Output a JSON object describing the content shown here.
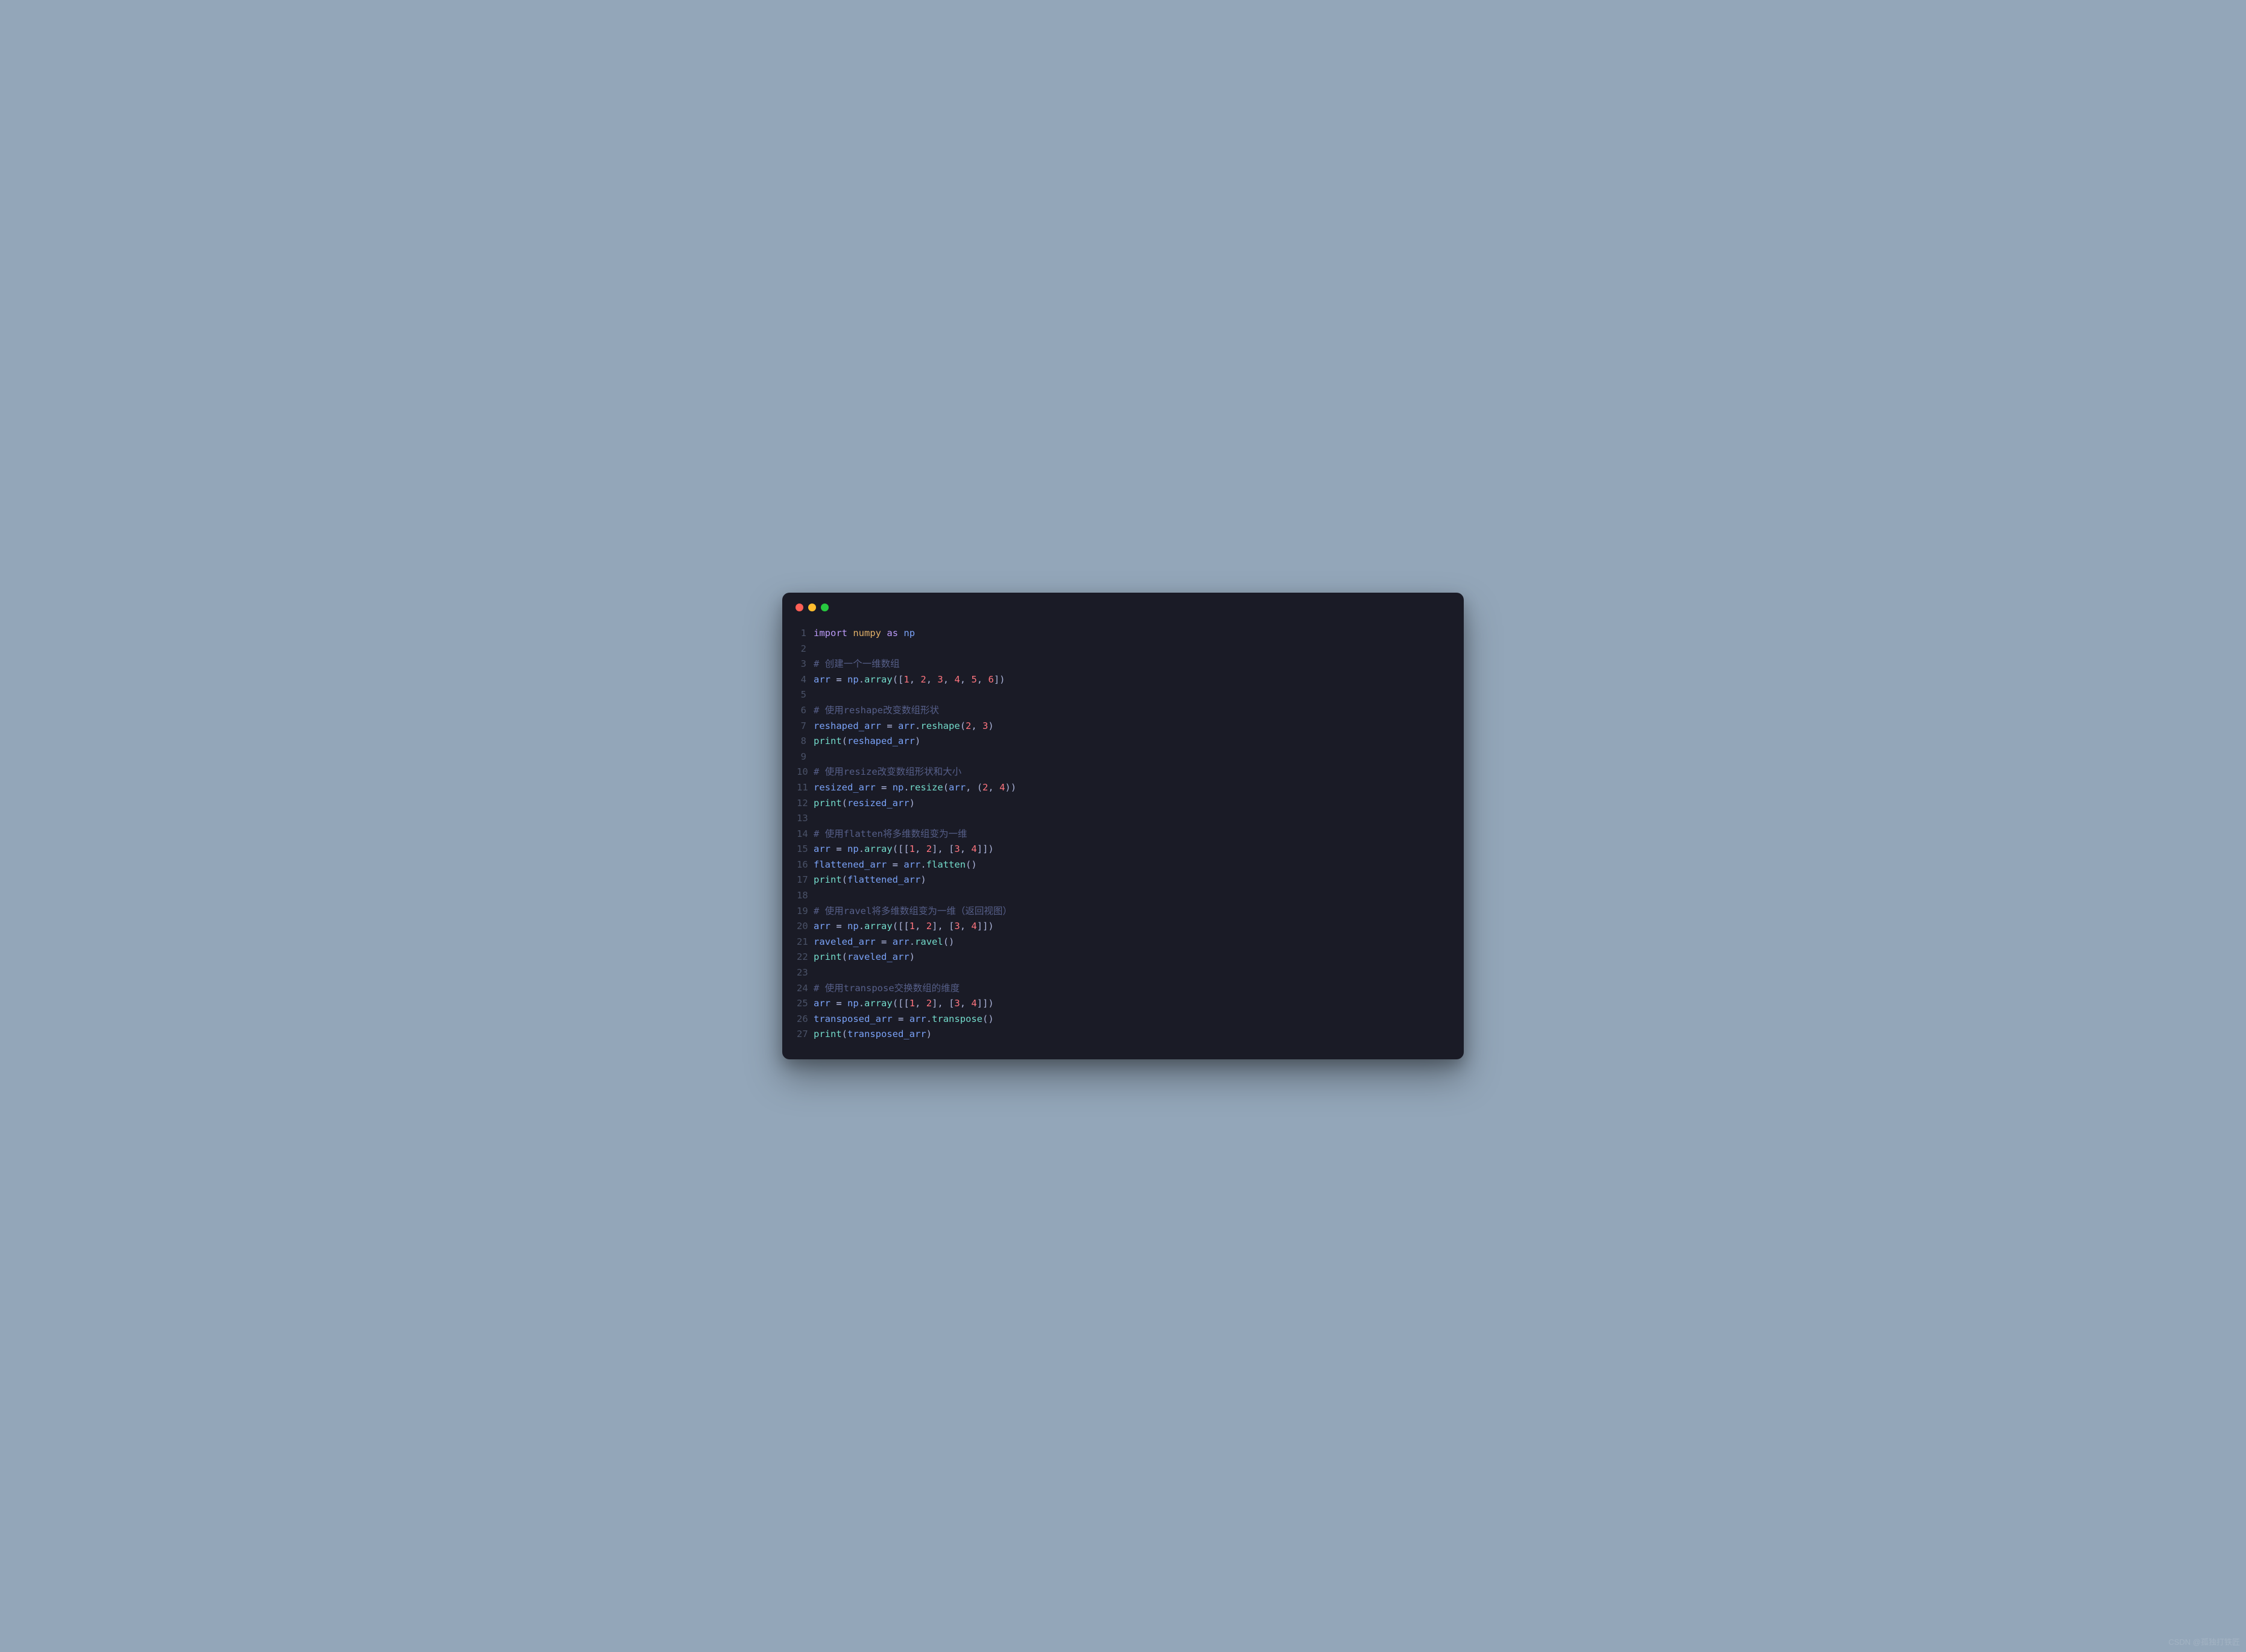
{
  "watermark": "CSDN @孤独打铁匠",
  "code": {
    "language": "python",
    "theme": "tokyo-night",
    "colors": {
      "bg": "#1a1b26",
      "page_bg": "#93a6b9",
      "keyword": "#bb9af7",
      "module": "#e0af68",
      "variable": "#7aa2f7",
      "function": "#73daca",
      "operator": "#c0caf5",
      "punctuation": "#a9b1d6",
      "number": "#ff757f",
      "comment": "#565f89",
      "linenum": "#4a5268"
    },
    "lines": [
      {
        "n": 1,
        "t": [
          {
            "c": "kw",
            "s": "import"
          },
          {
            "c": "pl",
            "s": " "
          },
          {
            "c": "mod",
            "s": "numpy"
          },
          {
            "c": "pl",
            "s": " "
          },
          {
            "c": "kw",
            "s": "as"
          },
          {
            "c": "pl",
            "s": " "
          },
          {
            "c": "var",
            "s": "np"
          }
        ]
      },
      {
        "n": 2,
        "t": []
      },
      {
        "n": 3,
        "t": [
          {
            "c": "cmt",
            "s": "# 创建一个一维数组"
          }
        ]
      },
      {
        "n": 4,
        "t": [
          {
            "c": "var",
            "s": "arr"
          },
          {
            "c": "pl",
            "s": " "
          },
          {
            "c": "op",
            "s": "="
          },
          {
            "c": "pl",
            "s": " "
          },
          {
            "c": "var",
            "s": "np"
          },
          {
            "c": "punc",
            "s": "."
          },
          {
            "c": "fn",
            "s": "array"
          },
          {
            "c": "punc",
            "s": "(["
          },
          {
            "c": "num",
            "s": "1"
          },
          {
            "c": "punc",
            "s": ", "
          },
          {
            "c": "num",
            "s": "2"
          },
          {
            "c": "punc",
            "s": ", "
          },
          {
            "c": "num",
            "s": "3"
          },
          {
            "c": "punc",
            "s": ", "
          },
          {
            "c": "num",
            "s": "4"
          },
          {
            "c": "punc",
            "s": ", "
          },
          {
            "c": "num",
            "s": "5"
          },
          {
            "c": "punc",
            "s": ", "
          },
          {
            "c": "num",
            "s": "6"
          },
          {
            "c": "punc",
            "s": "])"
          }
        ]
      },
      {
        "n": 5,
        "t": []
      },
      {
        "n": 6,
        "t": [
          {
            "c": "cmt",
            "s": "# 使用reshape改变数组形状"
          }
        ]
      },
      {
        "n": 7,
        "t": [
          {
            "c": "var",
            "s": "reshaped_arr"
          },
          {
            "c": "pl",
            "s": " "
          },
          {
            "c": "op",
            "s": "="
          },
          {
            "c": "pl",
            "s": " "
          },
          {
            "c": "var",
            "s": "arr"
          },
          {
            "c": "punc",
            "s": "."
          },
          {
            "c": "fn",
            "s": "reshape"
          },
          {
            "c": "punc",
            "s": "("
          },
          {
            "c": "num",
            "s": "2"
          },
          {
            "c": "punc",
            "s": ", "
          },
          {
            "c": "num",
            "s": "3"
          },
          {
            "c": "punc",
            "s": ")"
          }
        ]
      },
      {
        "n": 8,
        "t": [
          {
            "c": "fn",
            "s": "print"
          },
          {
            "c": "punc",
            "s": "("
          },
          {
            "c": "var",
            "s": "reshaped_arr"
          },
          {
            "c": "punc",
            "s": ")"
          }
        ]
      },
      {
        "n": 9,
        "t": []
      },
      {
        "n": 10,
        "t": [
          {
            "c": "cmt",
            "s": "# 使用resize改变数组形状和大小"
          }
        ]
      },
      {
        "n": 11,
        "t": [
          {
            "c": "var",
            "s": "resized_arr"
          },
          {
            "c": "pl",
            "s": " "
          },
          {
            "c": "op",
            "s": "="
          },
          {
            "c": "pl",
            "s": " "
          },
          {
            "c": "var",
            "s": "np"
          },
          {
            "c": "punc",
            "s": "."
          },
          {
            "c": "fn",
            "s": "resize"
          },
          {
            "c": "punc",
            "s": "("
          },
          {
            "c": "var",
            "s": "arr"
          },
          {
            "c": "punc",
            "s": ", ("
          },
          {
            "c": "num",
            "s": "2"
          },
          {
            "c": "punc",
            "s": ", "
          },
          {
            "c": "num",
            "s": "4"
          },
          {
            "c": "punc",
            "s": "))"
          }
        ]
      },
      {
        "n": 12,
        "t": [
          {
            "c": "fn",
            "s": "print"
          },
          {
            "c": "punc",
            "s": "("
          },
          {
            "c": "var",
            "s": "resized_arr"
          },
          {
            "c": "punc",
            "s": ")"
          }
        ]
      },
      {
        "n": 13,
        "t": []
      },
      {
        "n": 14,
        "t": [
          {
            "c": "cmt",
            "s": "# 使用flatten将多维数组变为一维"
          }
        ]
      },
      {
        "n": 15,
        "t": [
          {
            "c": "var",
            "s": "arr"
          },
          {
            "c": "pl",
            "s": " "
          },
          {
            "c": "op",
            "s": "="
          },
          {
            "c": "pl",
            "s": " "
          },
          {
            "c": "var",
            "s": "np"
          },
          {
            "c": "punc",
            "s": "."
          },
          {
            "c": "fn",
            "s": "array"
          },
          {
            "c": "punc",
            "s": "([["
          },
          {
            "c": "num",
            "s": "1"
          },
          {
            "c": "punc",
            "s": ", "
          },
          {
            "c": "num",
            "s": "2"
          },
          {
            "c": "punc",
            "s": "], ["
          },
          {
            "c": "num",
            "s": "3"
          },
          {
            "c": "punc",
            "s": ", "
          },
          {
            "c": "num",
            "s": "4"
          },
          {
            "c": "punc",
            "s": "]])"
          }
        ]
      },
      {
        "n": 16,
        "t": [
          {
            "c": "var",
            "s": "flattened_arr"
          },
          {
            "c": "pl",
            "s": " "
          },
          {
            "c": "op",
            "s": "="
          },
          {
            "c": "pl",
            "s": " "
          },
          {
            "c": "var",
            "s": "arr"
          },
          {
            "c": "punc",
            "s": "."
          },
          {
            "c": "fn",
            "s": "flatten"
          },
          {
            "c": "punc",
            "s": "()"
          }
        ]
      },
      {
        "n": 17,
        "t": [
          {
            "c": "fn",
            "s": "print"
          },
          {
            "c": "punc",
            "s": "("
          },
          {
            "c": "var",
            "s": "flattened_arr"
          },
          {
            "c": "punc",
            "s": ")"
          }
        ]
      },
      {
        "n": 18,
        "t": []
      },
      {
        "n": 19,
        "t": [
          {
            "c": "cmt",
            "s": "# 使用ravel将多维数组变为一维（返回视图）"
          }
        ]
      },
      {
        "n": 20,
        "t": [
          {
            "c": "var",
            "s": "arr"
          },
          {
            "c": "pl",
            "s": " "
          },
          {
            "c": "op",
            "s": "="
          },
          {
            "c": "pl",
            "s": " "
          },
          {
            "c": "var",
            "s": "np"
          },
          {
            "c": "punc",
            "s": "."
          },
          {
            "c": "fn",
            "s": "array"
          },
          {
            "c": "punc",
            "s": "([["
          },
          {
            "c": "num",
            "s": "1"
          },
          {
            "c": "punc",
            "s": ", "
          },
          {
            "c": "num",
            "s": "2"
          },
          {
            "c": "punc",
            "s": "], ["
          },
          {
            "c": "num",
            "s": "3"
          },
          {
            "c": "punc",
            "s": ", "
          },
          {
            "c": "num",
            "s": "4"
          },
          {
            "c": "punc",
            "s": "]])"
          }
        ]
      },
      {
        "n": 21,
        "t": [
          {
            "c": "var",
            "s": "raveled_arr"
          },
          {
            "c": "pl",
            "s": " "
          },
          {
            "c": "op",
            "s": "="
          },
          {
            "c": "pl",
            "s": " "
          },
          {
            "c": "var",
            "s": "arr"
          },
          {
            "c": "punc",
            "s": "."
          },
          {
            "c": "fn",
            "s": "ravel"
          },
          {
            "c": "punc",
            "s": "()"
          }
        ]
      },
      {
        "n": 22,
        "t": [
          {
            "c": "fn",
            "s": "print"
          },
          {
            "c": "punc",
            "s": "("
          },
          {
            "c": "var",
            "s": "raveled_arr"
          },
          {
            "c": "punc",
            "s": ")"
          }
        ]
      },
      {
        "n": 23,
        "t": []
      },
      {
        "n": 24,
        "t": [
          {
            "c": "cmt",
            "s": "# 使用transpose交换数组的维度"
          }
        ]
      },
      {
        "n": 25,
        "t": [
          {
            "c": "var",
            "s": "arr"
          },
          {
            "c": "pl",
            "s": " "
          },
          {
            "c": "op",
            "s": "="
          },
          {
            "c": "pl",
            "s": " "
          },
          {
            "c": "var",
            "s": "np"
          },
          {
            "c": "punc",
            "s": "."
          },
          {
            "c": "fn",
            "s": "array"
          },
          {
            "c": "punc",
            "s": "([["
          },
          {
            "c": "num",
            "s": "1"
          },
          {
            "c": "punc",
            "s": ", "
          },
          {
            "c": "num",
            "s": "2"
          },
          {
            "c": "punc",
            "s": "], ["
          },
          {
            "c": "num",
            "s": "3"
          },
          {
            "c": "punc",
            "s": ", "
          },
          {
            "c": "num",
            "s": "4"
          },
          {
            "c": "punc",
            "s": "]])"
          }
        ]
      },
      {
        "n": 26,
        "t": [
          {
            "c": "var",
            "s": "transposed_arr"
          },
          {
            "c": "pl",
            "s": " "
          },
          {
            "c": "op",
            "s": "="
          },
          {
            "c": "pl",
            "s": " "
          },
          {
            "c": "var",
            "s": "arr"
          },
          {
            "c": "punc",
            "s": "."
          },
          {
            "c": "fn",
            "s": "transpose"
          },
          {
            "c": "punc",
            "s": "()"
          }
        ]
      },
      {
        "n": 27,
        "t": [
          {
            "c": "fn",
            "s": "print"
          },
          {
            "c": "punc",
            "s": "("
          },
          {
            "c": "var",
            "s": "transposed_arr"
          },
          {
            "c": "punc",
            "s": ")"
          }
        ]
      }
    ]
  }
}
